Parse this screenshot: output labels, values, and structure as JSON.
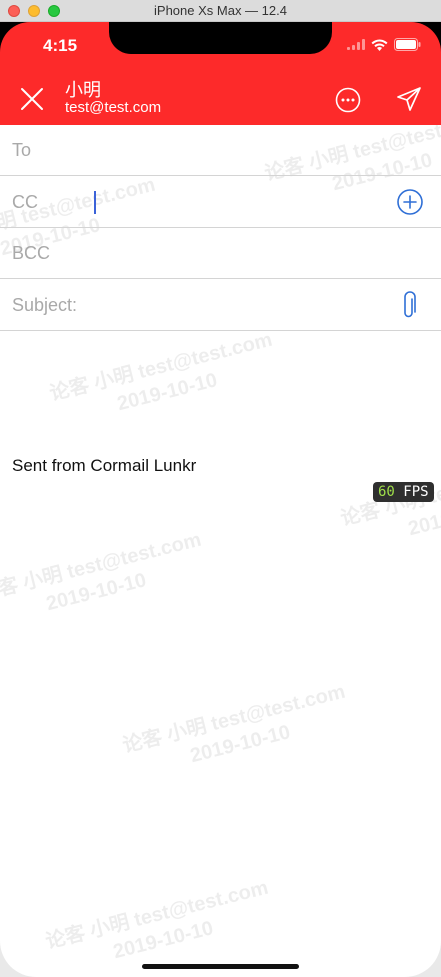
{
  "window": {
    "title": "iPhone Xs Max — 12.4"
  },
  "status_bar": {
    "time": "4:15"
  },
  "header": {
    "sender_name": "小明",
    "sender_email": "test@test.com",
    "close_icon": "close-icon",
    "more_icon": "more-icon",
    "send_icon": "send-icon",
    "color": "#fd2a2a"
  },
  "fields": {
    "to_label": "To",
    "cc_label": "CC",
    "bcc_label": "BCC",
    "subject_label": "Subject:"
  },
  "body": {
    "signature": "Sent from Cormail Lunkr"
  },
  "fps": {
    "value": "60",
    "unit": "FPS"
  },
  "watermark": {
    "line1": "论客 小明 test@test.com",
    "line2": "2019-10-10"
  }
}
